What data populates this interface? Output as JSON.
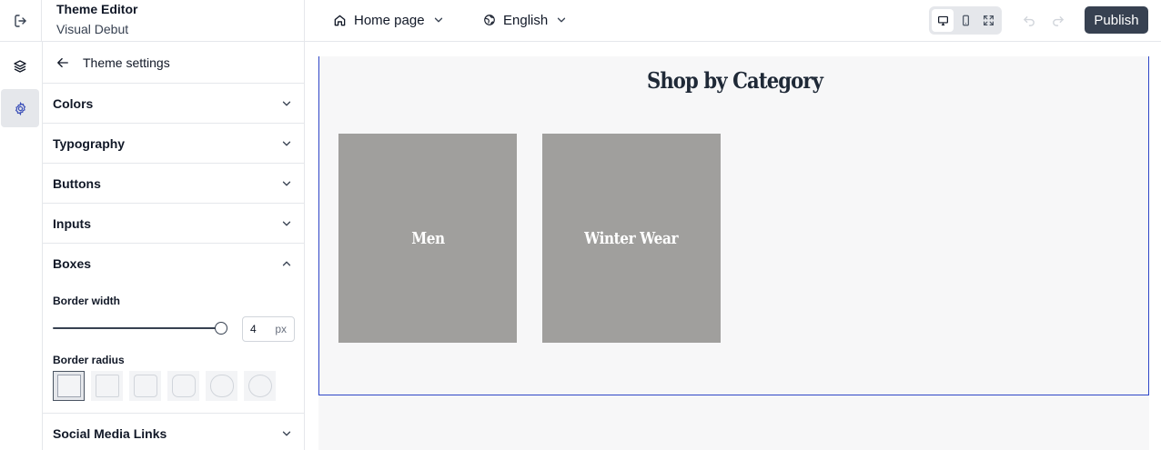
{
  "app": {
    "title": "Theme Editor",
    "subtitle": "Visual Debut"
  },
  "toolbar": {
    "page_select": "Home page",
    "language_select": "English",
    "publish_label": "Publish",
    "view_modes": [
      "desktop",
      "mobile",
      "fullscreen"
    ],
    "active_view": "desktop"
  },
  "rail": {
    "items": [
      "layers",
      "settings"
    ],
    "active": "settings"
  },
  "panel": {
    "title": "Theme settings",
    "sections": {
      "colors": "Colors",
      "typography": "Typography",
      "buttons": "Buttons",
      "inputs": "Inputs",
      "boxes": "Boxes",
      "social": "Social Media Links"
    },
    "boxes": {
      "border_width_label": "Border width",
      "border_width_value": "4",
      "border_width_unit": "px",
      "border_width_fraction": 1.0,
      "border_radius_label": "Border radius",
      "border_radius_selected": 0
    }
  },
  "preview": {
    "section_title": "Shop by Category",
    "categories": [
      "Men",
      "Winter Wear"
    ]
  },
  "colors": {
    "accent": "#2f46c7",
    "publish_bg": "#374151",
    "card_bg": "#a09f9d"
  }
}
